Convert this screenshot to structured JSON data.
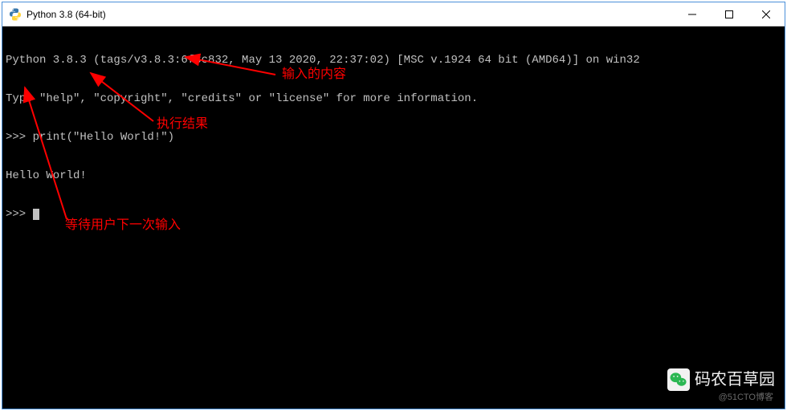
{
  "window": {
    "title": "Python 3.8 (64-bit)"
  },
  "terminal": {
    "line1": "Python 3.8.3 (tags/v3.8.3:6f8c832, May 13 2020, 22:37:02) [MSC v.1924 64 bit (AMD64)] on win32",
    "line2": "Type \"help\", \"copyright\", \"credits\" or \"license\" for more information.",
    "line3": ">>> print(\"Hello World!\")",
    "line4": "Hello World!",
    "line5_prompt": ">>> "
  },
  "annotations": {
    "input_label": "输入的内容",
    "result_label": "执行结果",
    "wait_label": "等待用户下一次输入"
  },
  "watermark": {
    "main": "码农百草园",
    "sub": "@51CTO博客"
  },
  "colors": {
    "annotation": "#ff0000",
    "terminal_fg": "#c0c0c0",
    "terminal_bg": "#000000"
  }
}
